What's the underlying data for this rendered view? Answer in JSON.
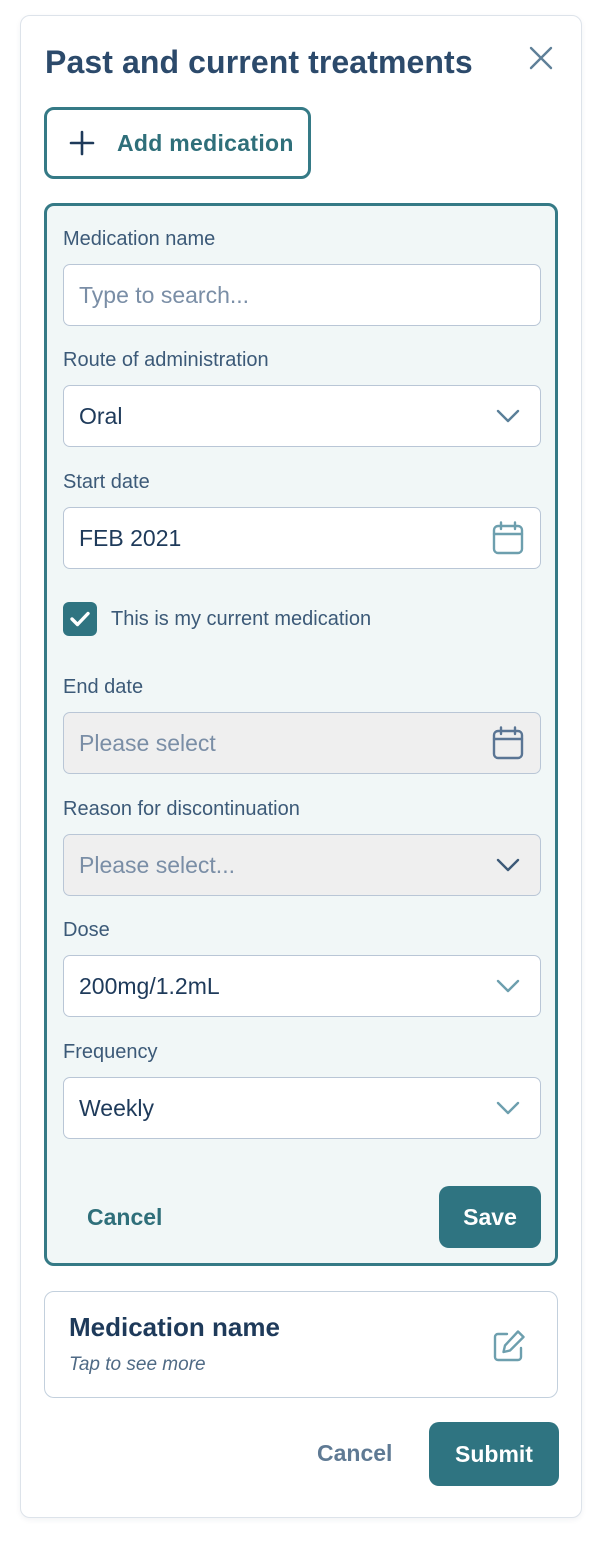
{
  "header": {
    "title": "Past and current treatments",
    "close_icon": "close-icon"
  },
  "add_medication": {
    "label": "Add medication",
    "icon": "plus-icon"
  },
  "form": {
    "medication_name": {
      "label": "Medication name",
      "placeholder": "Type to search..."
    },
    "route": {
      "label": "Route of administration",
      "value": "Oral"
    },
    "start_date": {
      "label": "Start date",
      "value": "FEB 2021"
    },
    "current_checkbox": {
      "label": "This is my current medication",
      "checked": true
    },
    "end_date": {
      "label": "End date",
      "placeholder": "Please select"
    },
    "reason": {
      "label": "Reason for discontinuation",
      "placeholder": "Please select..."
    },
    "dose": {
      "label": "Dose",
      "value": "200mg/1.2mL"
    },
    "frequency": {
      "label": "Frequency",
      "value": "Weekly"
    },
    "cancel_label": "Cancel",
    "save_label": "Save"
  },
  "medication_card": {
    "title": "Medication name",
    "subtitle": "Tap to see more",
    "icon": "edit-icon"
  },
  "footer": {
    "cancel_label": "Cancel",
    "submit_label": "Submit"
  },
  "colors": {
    "primary": "#2f7481",
    "title": "#2c4a6b",
    "form_bg": "#f1f7f7",
    "disabled_bg": "#efefef"
  }
}
